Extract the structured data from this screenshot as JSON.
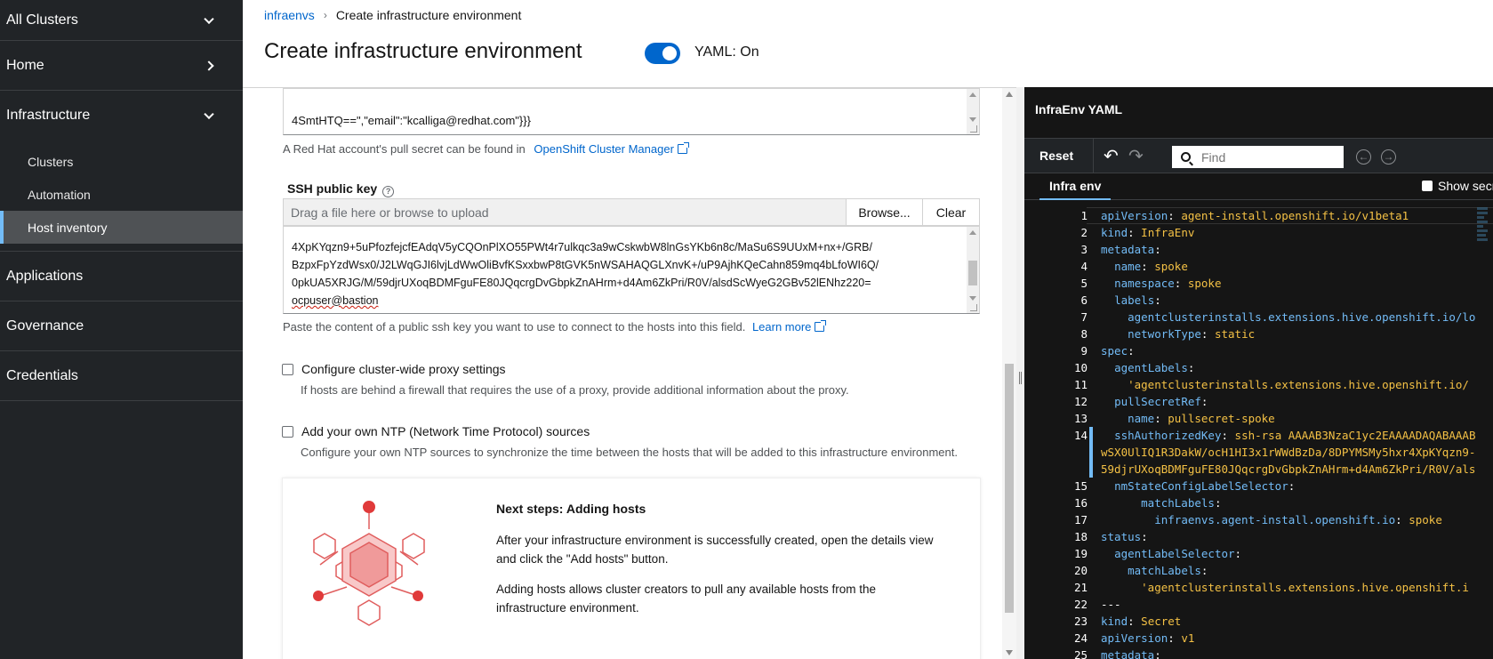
{
  "sidebar": {
    "cluster_switcher": "All Clusters",
    "items": [
      {
        "label": "Home"
      },
      {
        "label": "Infrastructure"
      },
      {
        "label": "Applications"
      },
      {
        "label": "Governance"
      },
      {
        "label": "Credentials"
      }
    ],
    "infrastructure_sub": [
      {
        "label": "Clusters"
      },
      {
        "label": "Automation"
      },
      {
        "label": "Host inventory"
      }
    ]
  },
  "header": {
    "breadcrumb_link": "infraenvs",
    "breadcrumb_current": "Create infrastructure environment",
    "title": "Create infrastructure environment",
    "yaml_toggle_label": "YAML: On"
  },
  "form": {
    "pull_secret_lines": [
      "4SmtHTQ==\",\"email\":\"kcalliga@redhat.com\"}}}"
    ],
    "pull_secret_helper": "A Red Hat account's pull secret can be found in",
    "pull_secret_link": "OpenShift Cluster Manager",
    "ssh_label": "SSH public key",
    "upload_placeholder": "Drag a file here or browse to upload",
    "browse_label": "Browse...",
    "clear_label": "Clear",
    "ssh_lines": [
      "4XpKYqzn9+5uPfozfejcfEAdqV5yCQOnPlXO55PWt4r7ulkqc3a9wCskwbW8lnGsYKb6n8c/MaSu6S9UUxM+nx+/GRB/",
      "BzpxFpYzdWsx0/J2LWqGJI6lvjLdWwOliBvfKSxxbwP8tGVK5nWSAHAQGLXnvK+/uP9AjhKQeCahn859mq4bLfoWI6Q/",
      "0pkUA5XRJG/M/59djrUXoqBDMFguFE80JQqcrgDvGbpkZnAHrm+d4Am6ZkPri/R0V/alsdScWyeG2GBv52lENhz220=",
      "ocpuser@bastion"
    ],
    "ssh_helper": "Paste the content of a public ssh key you want to use to connect to the hosts into this field.",
    "ssh_learn_more": "Learn more",
    "proxy_label": "Configure cluster-wide proxy settings",
    "proxy_desc": "If hosts are behind a firewall that requires the use of a proxy, provide additional information about the proxy.",
    "ntp_label": "Add your own NTP (Network Time Protocol) sources",
    "ntp_desc": "Configure your own NTP sources to synchronize the time between the hosts that will be added to this infrastructure environment."
  },
  "next_steps": {
    "title": "Next steps: Adding hosts",
    "p1_a": "After your infrastructure environment is successfully created, open the details view",
    "p1_b": "and click the \"Add hosts\" button.",
    "p2_a": "Adding hosts allows cluster creators to pull any available hosts from the",
    "p2_b": "infrastructure environment."
  },
  "yaml": {
    "title": "InfraEnv YAML",
    "reset_label": "Reset",
    "find_placeholder": "Find",
    "tab_label": "Infra env",
    "show_secrets_label": "Show secr",
    "lines": [
      {
        "n": "1",
        "k": "apiVersion",
        "v": "agent-install.openshift.io/v1beta1",
        "indent": ""
      },
      {
        "n": "2",
        "k": "kind",
        "v": "InfraEnv",
        "indent": ""
      },
      {
        "n": "3",
        "k": "metadata",
        "v": "",
        "indent": ""
      },
      {
        "n": "4",
        "k": "name",
        "v": "spoke",
        "indent": "  "
      },
      {
        "n": "5",
        "k": "namespace",
        "v": "spoke",
        "indent": "  "
      },
      {
        "n": "6",
        "k": "labels",
        "v": "",
        "indent": "  "
      },
      {
        "n": "7",
        "k": "agentclusterinstalls.extensions.hive.openshift.io/lo",
        "v": "",
        "indent": "    ",
        "nocolon": true
      },
      {
        "n": "8",
        "k": "networkType",
        "v": "static",
        "indent": "    "
      },
      {
        "n": "9",
        "k": "spec",
        "v": "",
        "indent": ""
      },
      {
        "n": "10",
        "k": "agentLabels",
        "v": "",
        "indent": "  "
      },
      {
        "n": "11",
        "k": "",
        "v": "'agentclusterinstalls.extensions.hive.openshift.io/",
        "indent": "    ",
        "nocolon": true
      },
      {
        "n": "12",
        "k": "pullSecretRef",
        "v": "",
        "indent": "  "
      },
      {
        "n": "13",
        "k": "name",
        "v": "pullsecret-spoke",
        "indent": "    "
      },
      {
        "n": "14",
        "k": "sshAuthorizedKey",
        "v": "ssh-rsa AAAAB3NzaC1yc2EAAAADAQABAAAB",
        "indent": "  "
      },
      {
        "n": "",
        "k": "",
        "v": "wSX0UlIQ1R3DakW/ocH1HI3x1rWWdBzDa/8DPYMSMy5hxr4XpKYqzn9-",
        "indent": "",
        "nocolon": true
      },
      {
        "n": "",
        "k": "",
        "v": "59djrUXoqBDMFguFE80JQqcrgDvGbpkZnAHrm+d4Am6ZkPri/R0V/als",
        "indent": "",
        "nocolon": true
      },
      {
        "n": "15",
        "k": "nmStateConfigLabelSelector",
        "v": "",
        "indent": "  "
      },
      {
        "n": "16",
        "k": "matchLabels",
        "v": "",
        "indent": "      "
      },
      {
        "n": "17",
        "k": "infraenvs.agent-install.openshift.io",
        "v": "spoke",
        "indent": "        "
      },
      {
        "n": "18",
        "k": "status",
        "v": "",
        "indent": ""
      },
      {
        "n": "19",
        "k": "agentLabelSelector",
        "v": "",
        "indent": "  "
      },
      {
        "n": "20",
        "k": "matchLabels",
        "v": "",
        "indent": "    "
      },
      {
        "n": "21",
        "k": "",
        "v": "'agentclusterinstalls.extensions.hive.openshift.i",
        "indent": "      ",
        "nocolon": true
      },
      {
        "n": "22",
        "k": "",
        "v": "---",
        "indent": "",
        "nocolon": true,
        "plain": true
      },
      {
        "n": "23",
        "k": "kind",
        "v": "Secret",
        "indent": ""
      },
      {
        "n": "24",
        "k": "apiVersion",
        "v": "v1",
        "indent": ""
      },
      {
        "n": "25",
        "k": "metadata",
        "v": "",
        "indent": ""
      }
    ]
  },
  "colors": {
    "sidebar_bg": "#212427",
    "accent": "#0066cc",
    "yaml_bg": "#151515",
    "yaml_key": "#73bcf7",
    "yaml_value": "#f4c145",
    "illustration": "#e05d5d"
  }
}
